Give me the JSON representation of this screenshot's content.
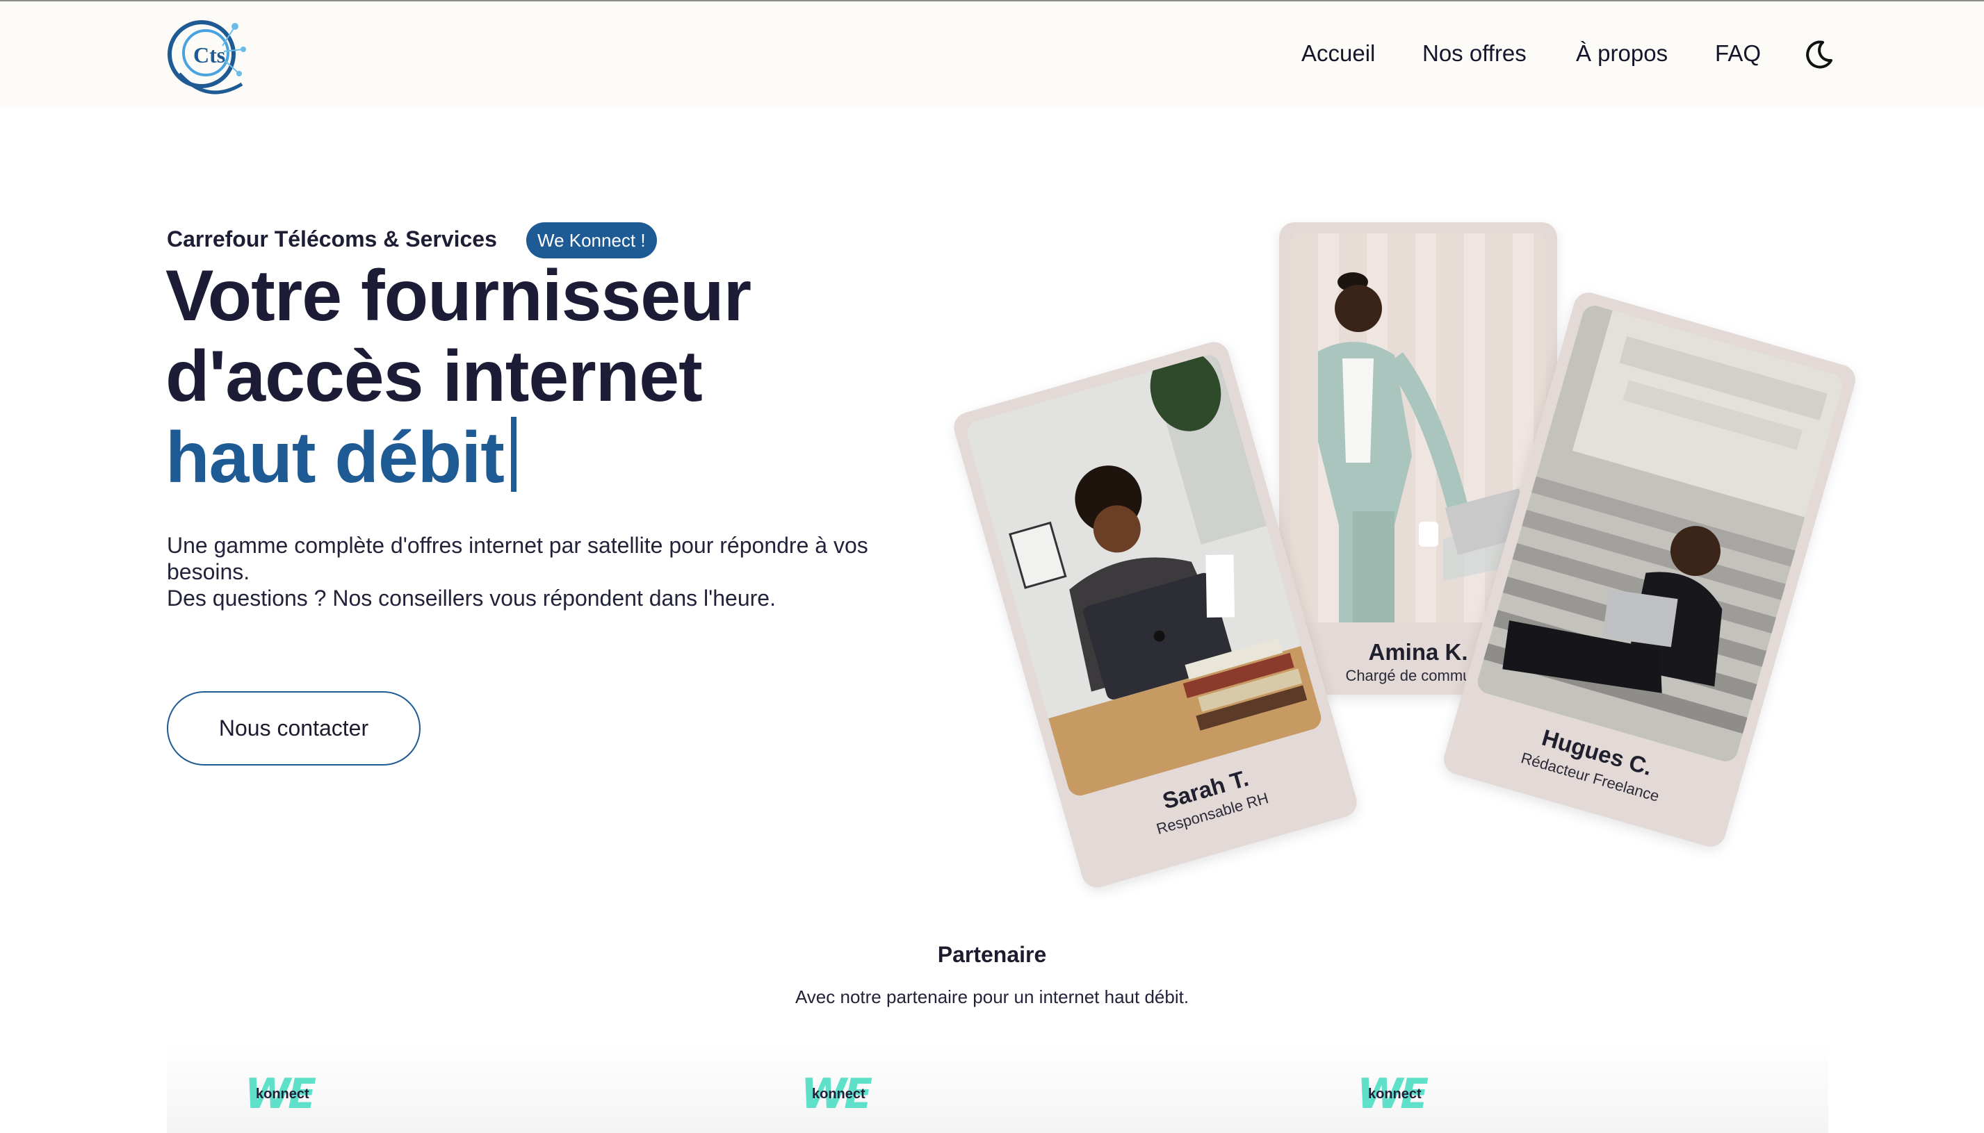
{
  "header": {
    "logo_text": "Cts",
    "nav": [
      {
        "label": "Accueil"
      },
      {
        "label": "Nos offres"
      },
      {
        "label": "À propos"
      },
      {
        "label": "FAQ"
      }
    ],
    "theme_icon": "moon-icon"
  },
  "hero": {
    "eyebrow": "Carrefour Télécoms & Services",
    "badge": "We Konnect !",
    "headline_line1": "Votre fournisseur",
    "headline_line2": "d'accès internet",
    "headline_accent": "haut débit",
    "lead_line1": "Une gamme complète d'offres internet par satellite pour répondre à vos besoins.",
    "lead_line2": "Des questions ? Nos conseillers vous répondent dans l'heure.",
    "cta": "Nous contacter"
  },
  "cards": [
    {
      "name": "Sarah T.",
      "role": "Responsable RH"
    },
    {
      "name": "Amina K.",
      "role": "Chargé de communic"
    },
    {
      "name": "Hugues C.",
      "role": "Rédacteur Freelance"
    }
  ],
  "partners": {
    "title": "Partenaire",
    "subtitle": "Avec notre partenaire pour un internet haut débit.",
    "logos": [
      {
        "we": "WE",
        "name": "konnect"
      },
      {
        "we": "WE",
        "name": "konnect"
      },
      {
        "we": "WE",
        "name": "konnect"
      }
    ]
  },
  "colors": {
    "brand_blue": "#1e5a93",
    "header_bg": "#fcfbf8",
    "card_bg": "#e3dad7",
    "partner_teal": "#5fe0c8"
  }
}
